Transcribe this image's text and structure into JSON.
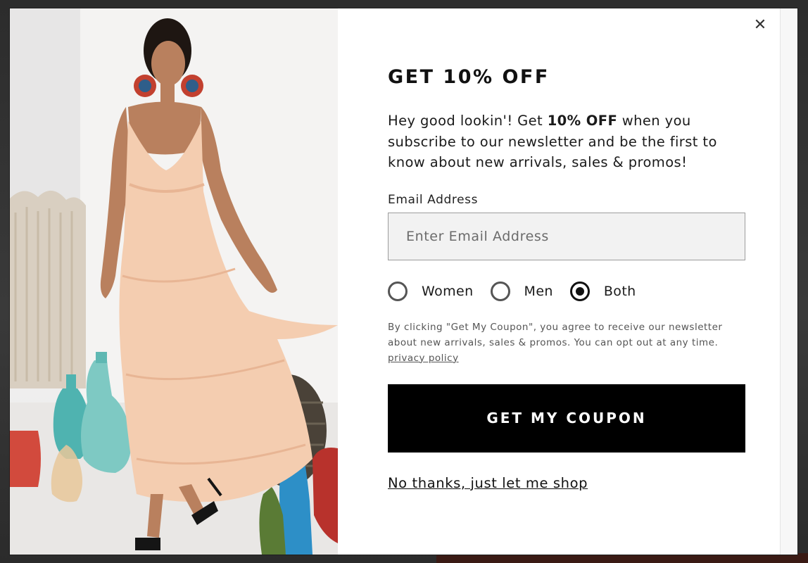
{
  "popup": {
    "headline": "GET 10% OFF",
    "intro_before": "Hey good lookin'! Get ",
    "intro_bold": "10% OFF",
    "intro_after": " when you subscribe to our newsletter and be the first to know about new arrivals, sales & promos!",
    "email_label": "Email Address",
    "email_placeholder": "Enter Email Address",
    "email_value": "",
    "radio_options": [
      {
        "label": "Women",
        "checked": false
      },
      {
        "label": "Men",
        "checked": false
      },
      {
        "label": "Both",
        "checked": true
      }
    ],
    "consent_text": "By clicking \"Get My Coupon\", you agree to receive our newsletter about new arrivals, sales & promos. You can opt out at any time.",
    "privacy_link": "privacy policy",
    "cta_label": "GET MY COUPON",
    "decline_label": "No thanks, just let me shop",
    "close_icon": "close-icon",
    "colors": {
      "cta_background": "#000000",
      "input_background": "#f2f2f2",
      "dress": "#f4cdb0"
    }
  }
}
